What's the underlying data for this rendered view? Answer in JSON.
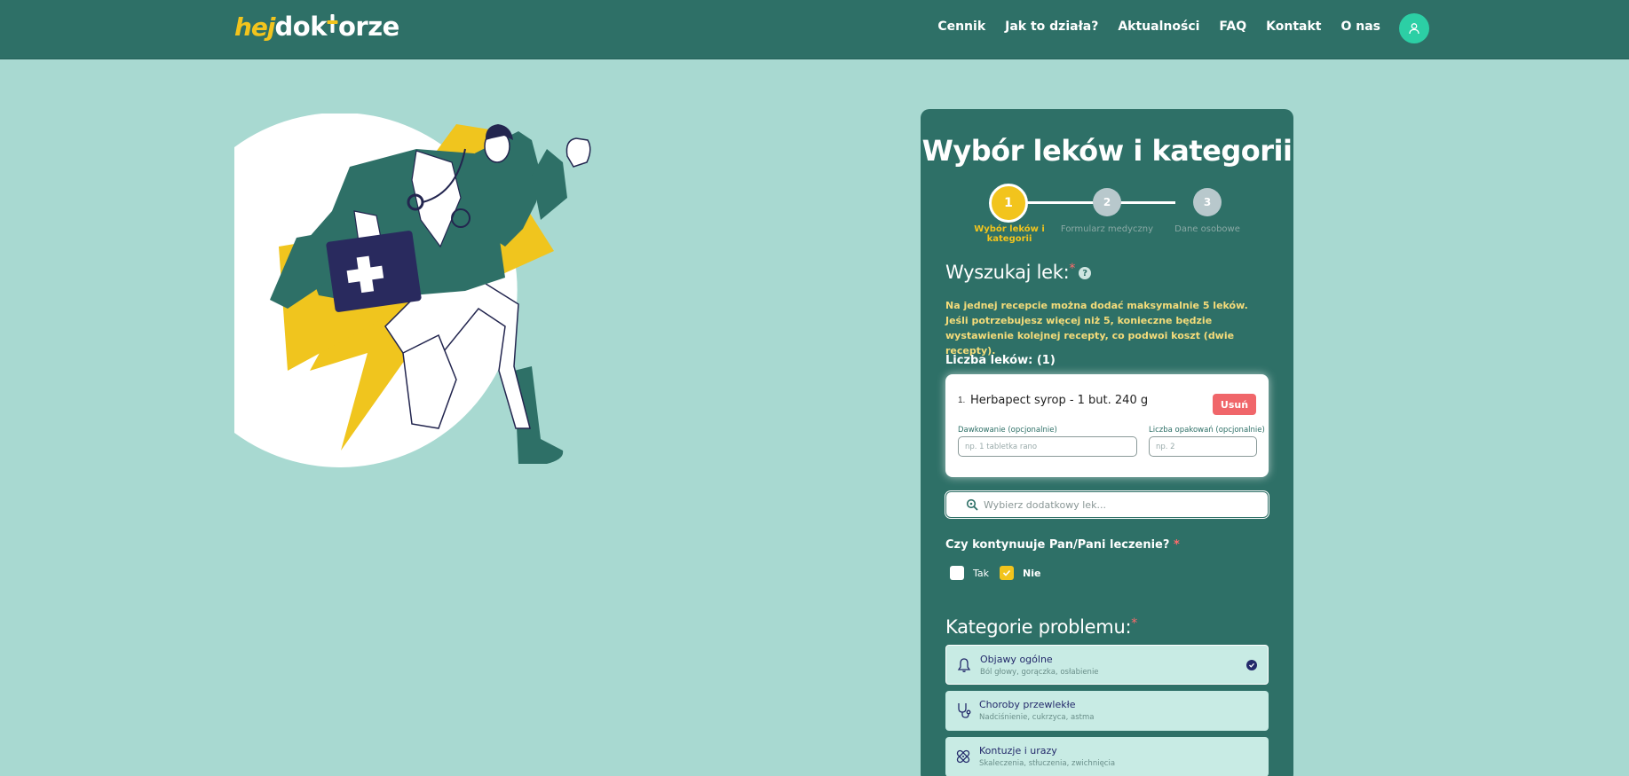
{
  "header": {
    "logo": {
      "part1": "hej",
      "part2": "dok",
      "part3": "orze"
    },
    "nav": [
      "Cennik",
      "Jak to działa?",
      "Aktualności",
      "FAQ",
      "Kontakt",
      "O nas"
    ]
  },
  "form": {
    "title": "Wybór leków i kategorii",
    "steps": [
      {
        "number": "1",
        "label": "Wybór leków i kategorii",
        "active": true
      },
      {
        "number": "2",
        "label": "Formularz medyczny",
        "active": false
      },
      {
        "number": "3",
        "label": "Dane osobowe",
        "active": false
      }
    ],
    "search_heading": "Wyszukaj lek:",
    "required_mark": "*",
    "help_icon": "?",
    "note": "Na jednej recepcie można dodać maksymalnie 5 leków. Jeśli potrzebujesz więcej niż 5, konieczne będzie wystawienie kolejnej recepty, co podwoi koszt (dwie recepty).",
    "count_label": "Liczba leków: (1)",
    "drugs": [
      {
        "index": "1.",
        "name": "Herbapect syrop - 1 but. 240 g",
        "remove_label": "Usuń",
        "dosage_label": "Dawkowanie (opcjonalnie)",
        "dosage_placeholder": "np. 1 tabletka rano",
        "packages_label": "Liczba opakowań (opcjonalnie)",
        "packages_placeholder": "np. 2"
      }
    ],
    "additional_search_placeholder": "Wybierz dodatkowy lek...",
    "continue_question": "Czy kontynuuje Pan/Pani leczenie?",
    "continue_options": [
      {
        "label": "Tak",
        "checked": false
      },
      {
        "label": "Nie",
        "checked": true
      }
    ],
    "categories_heading": "Kategorie problemu:",
    "categories": [
      {
        "title": "Objawy ogólne",
        "subtitle": "Ból głowy, gorączka, osłabienie",
        "icon": "bell-icon",
        "selected": true
      },
      {
        "title": "Choroby przewlekłe",
        "subtitle": "Nadciśnienie, cukrzyca, astma",
        "icon": "stethoscope-icon",
        "selected": false
      },
      {
        "title": "Kontuzje i urazy",
        "subtitle": "Skaleczenia, stłuczenia, zwichnięcia",
        "icon": "bandage-icon",
        "selected": false
      }
    ]
  },
  "colors": {
    "background": "#a8d9d1",
    "primary": "#2e7067",
    "accent": "#f2c41d",
    "danger": "#f0666a",
    "user_button": "#2ccfa5"
  }
}
